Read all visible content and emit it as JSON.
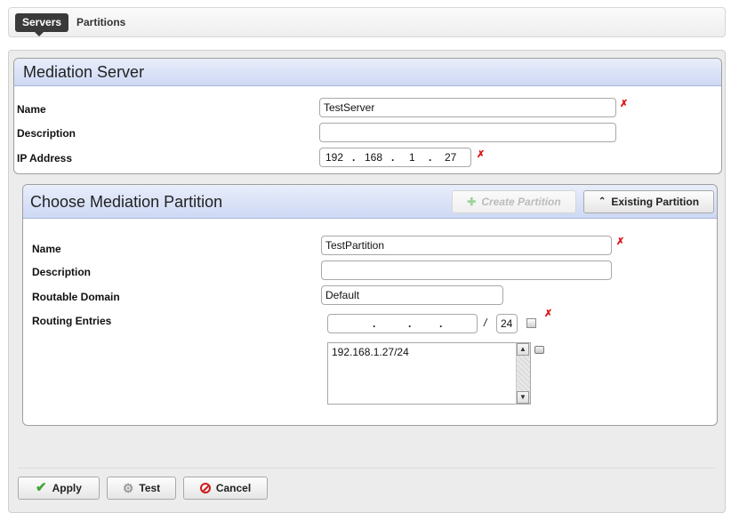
{
  "tabs": {
    "servers": "Servers",
    "partitions": "Partitions"
  },
  "server_panel": {
    "title": "Mediation Server",
    "name_label": "Name",
    "name_value": "TestServer",
    "description_label": "Description",
    "description_value": "",
    "ip_label": "IP Address",
    "ip_octets": [
      "192",
      "168",
      "1",
      "27"
    ],
    "ip_separator": "."
  },
  "partition_panel": {
    "title": "Choose Mediation Partition",
    "create_partition": "Create Partition",
    "existing_partition": "Existing Partition",
    "name_label": "Name",
    "name_value": "TestPartition",
    "description_label": "Description",
    "description_value": "",
    "routable_domain_label": "Routable Domain",
    "routable_domain_value": "Default",
    "routing_entries_label": "Routing Entries",
    "route_separator": "/",
    "prefix_length": "24",
    "routing_entries": [
      "192.168.1.27/24"
    ]
  },
  "footer": {
    "apply": "Apply",
    "test": "Test",
    "cancel": "Cancel"
  },
  "colors": {
    "header_gradient_top": "#e9eefb",
    "header_gradient_bottom": "#cdd8f4",
    "required": "#dd1111",
    "apply_check": "#3fa535",
    "cancel_icon": "#d01a1a"
  }
}
